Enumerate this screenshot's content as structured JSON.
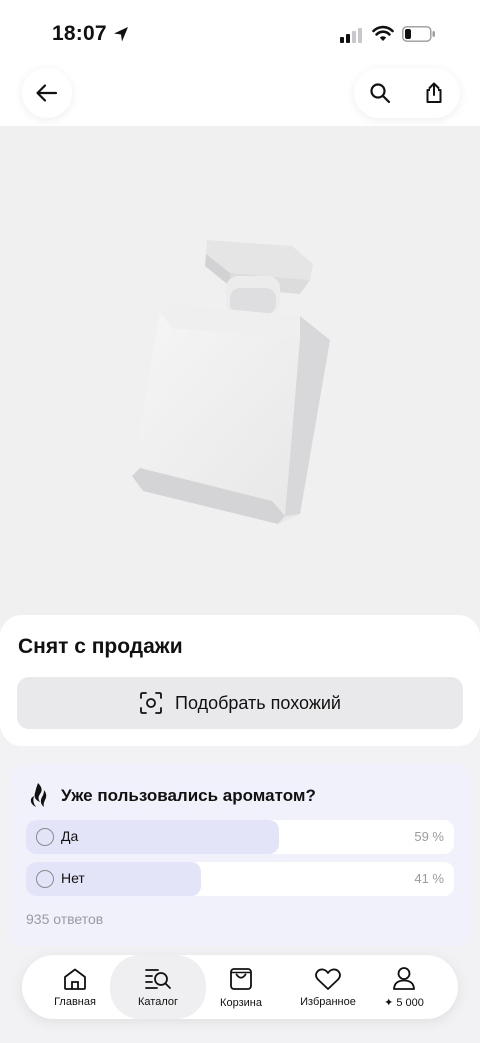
{
  "status_bar": {
    "time": "18:07"
  },
  "product": {
    "status_title": "Снят с продажи",
    "similar_button": "Подобрать похожий"
  },
  "poll": {
    "question": "Уже пользовались ароматом?",
    "options": [
      {
        "label": "Да",
        "percent_text": "59 %",
        "fraction": 0.59
      },
      {
        "label": "Нет",
        "percent_text": "41 %",
        "fraction": 0.41
      }
    ],
    "responses": "935 ответов"
  },
  "nav": {
    "items": [
      {
        "label": "Главная",
        "icon": "home-icon"
      },
      {
        "label": "Каталог",
        "icon": "catalog-search-icon",
        "active": true
      },
      {
        "label": "Корзина",
        "icon": "bag-icon"
      },
      {
        "label": "Избранное",
        "icon": "heart-icon"
      },
      {
        "label": "✦ 5 000",
        "icon": "profile-icon"
      }
    ]
  },
  "colors": {
    "accent_light": "#e4e4f8",
    "poll_bg": "#f1f1fb",
    "page_bg": "#f2f2f4"
  }
}
